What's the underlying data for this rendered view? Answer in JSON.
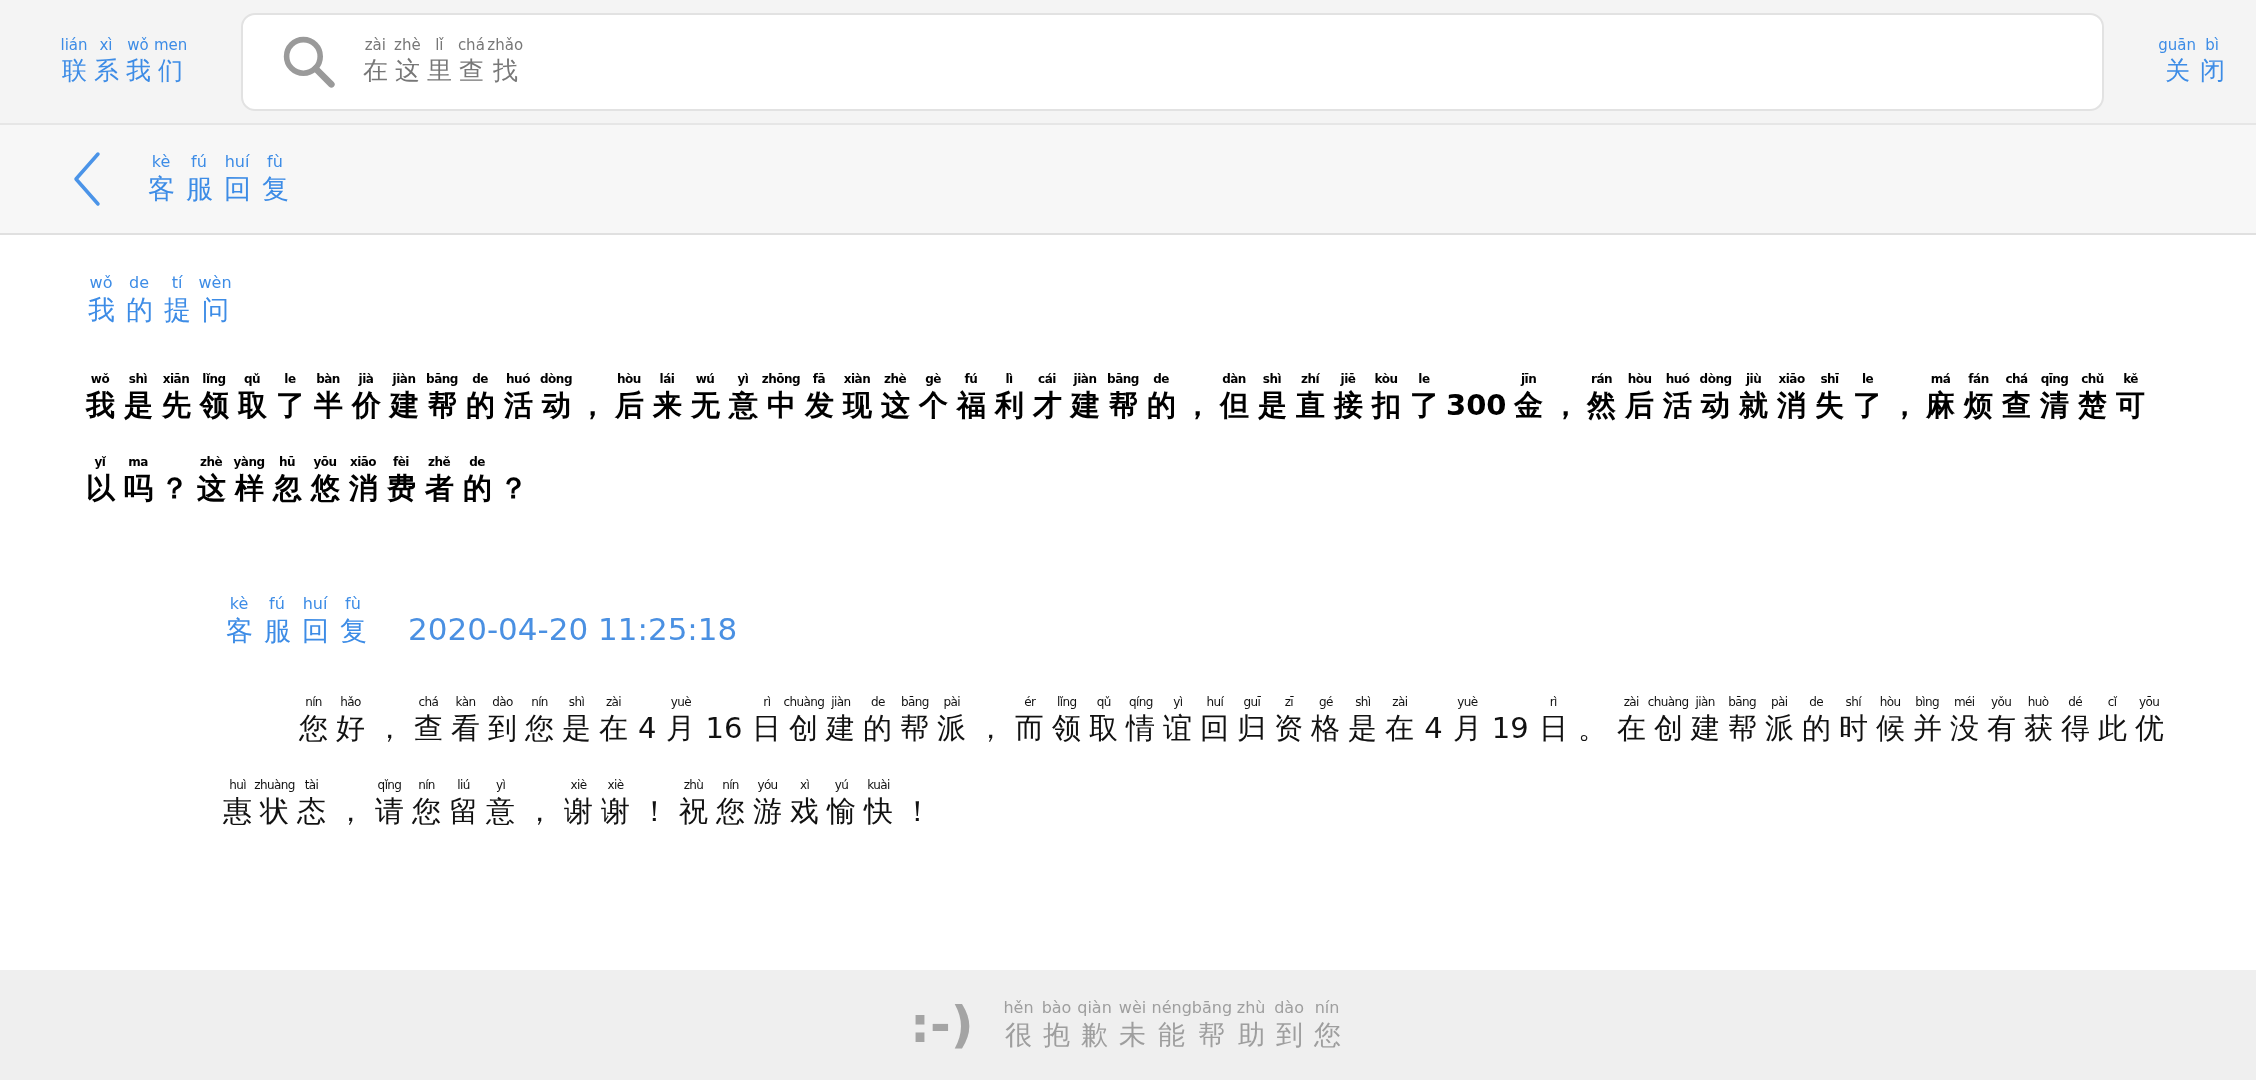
{
  "top_bar": {
    "contact": [
      [
        "lián",
        "联"
      ],
      [
        "xì",
        "系"
      ],
      [
        "wǒ",
        "我"
      ],
      [
        "men",
        "们"
      ]
    ],
    "search": {
      "placeholder": [
        [
          "zài",
          "在"
        ],
        [
          "zhè",
          "这"
        ],
        [
          "lǐ",
          "里"
        ],
        [
          "chá",
          "查"
        ],
        [
          "zhǎo",
          "找"
        ]
      ]
    },
    "close": [
      [
        "guān",
        "关"
      ],
      [
        "bì",
        "闭"
      ]
    ]
  },
  "header": {
    "title": [
      [
        "kè",
        "客"
      ],
      [
        "fú",
        "服"
      ],
      [
        "huí",
        "回"
      ],
      [
        "fù",
        "复"
      ]
    ]
  },
  "question": {
    "title": [
      [
        "wǒ",
        "我"
      ],
      [
        "de",
        "的"
      ],
      [
        "tí",
        "提"
      ],
      [
        "wèn",
        "问"
      ]
    ],
    "lines": [
      [
        [
          "wǒ",
          "我"
        ],
        [
          "shì",
          "是"
        ],
        [
          "xiān",
          "先"
        ],
        [
          "lǐng",
          "领"
        ],
        [
          "qǔ",
          "取"
        ],
        [
          "le",
          "了"
        ],
        [
          "bàn",
          "半"
        ],
        [
          "jià",
          "价"
        ],
        [
          "jiàn",
          "建"
        ],
        [
          "bāng",
          "帮"
        ],
        [
          "de",
          "的"
        ],
        [
          "huó",
          "活"
        ],
        [
          "dòng",
          "动"
        ],
        [
          "，"
        ],
        [
          "hòu",
          "后"
        ],
        [
          "lái",
          "来"
        ],
        [
          "wú",
          "无"
        ],
        [
          "yì",
          "意"
        ],
        [
          "zhōng",
          "中"
        ],
        [
          "fā",
          "发"
        ],
        [
          "xiàn",
          "现"
        ],
        [
          "zhè",
          "这"
        ],
        [
          "gè",
          "个"
        ],
        [
          "fú",
          "福"
        ],
        [
          "lì",
          "利"
        ],
        [
          "cái",
          "才"
        ],
        [
          "jiàn",
          "建"
        ],
        [
          "bāng",
          "帮"
        ],
        [
          "de",
          "的"
        ],
        [
          "，"
        ],
        [
          "dàn",
          "但"
        ],
        [
          "shì",
          "是"
        ],
        [
          "zhí",
          "直"
        ],
        [
          "jiē",
          "接"
        ],
        [
          "kòu",
          "扣"
        ],
        [
          "le",
          "了"
        ],
        [
          "300"
        ],
        [
          "jīn",
          "金"
        ],
        [
          "，"
        ],
        [
          "rán",
          "然"
        ],
        [
          "hòu",
          "后"
        ],
        [
          "huó",
          "活"
        ],
        [
          "dòng",
          "动"
        ],
        [
          "jiù",
          "就"
        ],
        [
          "xiāo",
          "消"
        ],
        [
          "shī",
          "失"
        ],
        [
          "le",
          "了"
        ],
        [
          "，"
        ],
        [
          "má",
          "麻"
        ],
        [
          "fán",
          "烦"
        ],
        [
          "chá",
          "查"
        ],
        [
          "qīng",
          "清"
        ],
        [
          "chǔ",
          "楚"
        ],
        [
          "kě",
          "可"
        ]
      ],
      [
        [
          "yǐ",
          "以"
        ],
        [
          "ma",
          "吗"
        ],
        [
          "？"
        ],
        [
          "zhè",
          "这"
        ],
        [
          "yàng",
          "样"
        ],
        [
          "hū",
          "忽"
        ],
        [
          "yōu",
          "悠"
        ],
        [
          "xiāo",
          "消"
        ],
        [
          "fèi",
          "费"
        ],
        [
          "zhě",
          "者"
        ],
        [
          "de",
          "的"
        ],
        [
          "？"
        ]
      ]
    ]
  },
  "reply": {
    "title": [
      [
        "kè",
        "客"
      ],
      [
        "fú",
        "服"
      ],
      [
        "huí",
        "回"
      ],
      [
        "fù",
        "复"
      ]
    ],
    "time": "2020-04-20 11:25:18",
    "lines": [
      [
        [
          "nín",
          "您"
        ],
        [
          "hǎo",
          "好"
        ],
        [
          "，"
        ],
        [
          "chá",
          "查"
        ],
        [
          "kàn",
          "看"
        ],
        [
          "dào",
          "到"
        ],
        [
          "nín",
          "您"
        ],
        [
          "shì",
          "是"
        ],
        [
          "zài",
          "在"
        ],
        [
          "4"
        ],
        [
          "yuè",
          "月"
        ],
        [
          "16"
        ],
        [
          "rì",
          "日"
        ],
        [
          "chuàng",
          "创"
        ],
        [
          "jiàn",
          "建"
        ],
        [
          "de",
          "的"
        ],
        [
          "bāng",
          "帮"
        ],
        [
          "pài",
          "派"
        ],
        [
          "，"
        ],
        [
          "ér",
          "而"
        ],
        [
          "lǐng",
          "领"
        ],
        [
          "qǔ",
          "取"
        ],
        [
          "qíng",
          "情"
        ],
        [
          "yì",
          "谊"
        ],
        [
          "huí",
          "回"
        ],
        [
          "guī",
          "归"
        ],
        [
          "zī",
          "资"
        ],
        [
          "gé",
          "格"
        ],
        [
          "shì",
          "是"
        ],
        [
          "zài",
          "在"
        ],
        [
          "4"
        ],
        [
          "yuè",
          "月"
        ],
        [
          "19"
        ],
        [
          "rì",
          "日"
        ],
        [
          "。"
        ],
        [
          "zài",
          "在"
        ],
        [
          "chuàng",
          "创"
        ],
        [
          "jiàn",
          "建"
        ],
        [
          "bāng",
          "帮"
        ],
        [
          "pài",
          "派"
        ],
        [
          "de",
          "的"
        ],
        [
          "shí",
          "时"
        ],
        [
          "hòu",
          "候"
        ],
        [
          "bìng",
          "并"
        ],
        [
          "méi",
          "没"
        ],
        [
          "yǒu",
          "有"
        ],
        [
          "huò",
          "获"
        ],
        [
          "dé",
          "得"
        ],
        [
          "cǐ",
          "此"
        ],
        [
          "yōu",
          "优"
        ]
      ],
      [
        [
          "huì",
          "惠"
        ],
        [
          "zhuàng",
          "状"
        ],
        [
          "tài",
          "态"
        ],
        [
          "，"
        ],
        [
          "qǐng",
          "请"
        ],
        [
          "nín",
          "您"
        ],
        [
          "liú",
          "留"
        ],
        [
          "yì",
          "意"
        ],
        [
          "，"
        ],
        [
          "xiè",
          "谢"
        ],
        [
          "xiè",
          "谢"
        ],
        [
          "！"
        ],
        [
          "zhù",
          "祝"
        ],
        [
          "nín",
          "您"
        ],
        [
          "yóu",
          "游"
        ],
        [
          "xì",
          "戏"
        ],
        [
          "yú",
          "愉"
        ],
        [
          "kuài",
          "快"
        ],
        [
          "！"
        ]
      ]
    ]
  },
  "footer": {
    "face": ":-)",
    "message": [
      [
        "hěn",
        "很"
      ],
      [
        "bào",
        "抱"
      ],
      [
        "qiàn",
        "歉"
      ],
      [
        "wèi",
        "未"
      ],
      [
        "néng",
        "能"
      ],
      [
        "bāng",
        "帮"
      ],
      [
        "zhù",
        "助"
      ],
      [
        "dào",
        "到"
      ],
      [
        "nín",
        "您"
      ]
    ]
  }
}
